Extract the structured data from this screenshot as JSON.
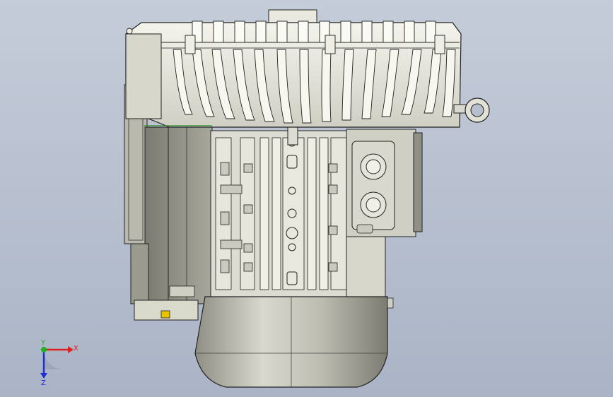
{
  "viewport": {
    "model": "motor-blower-assembly",
    "background_top": "#c5ccd9",
    "background_bottom": "#aab4c6"
  },
  "triad": {
    "x_label": "X",
    "y_label": "Y",
    "z_label": "Z",
    "x_color": "#e02020",
    "y_color": "#20b020",
    "z_color": "#2030d0"
  }
}
